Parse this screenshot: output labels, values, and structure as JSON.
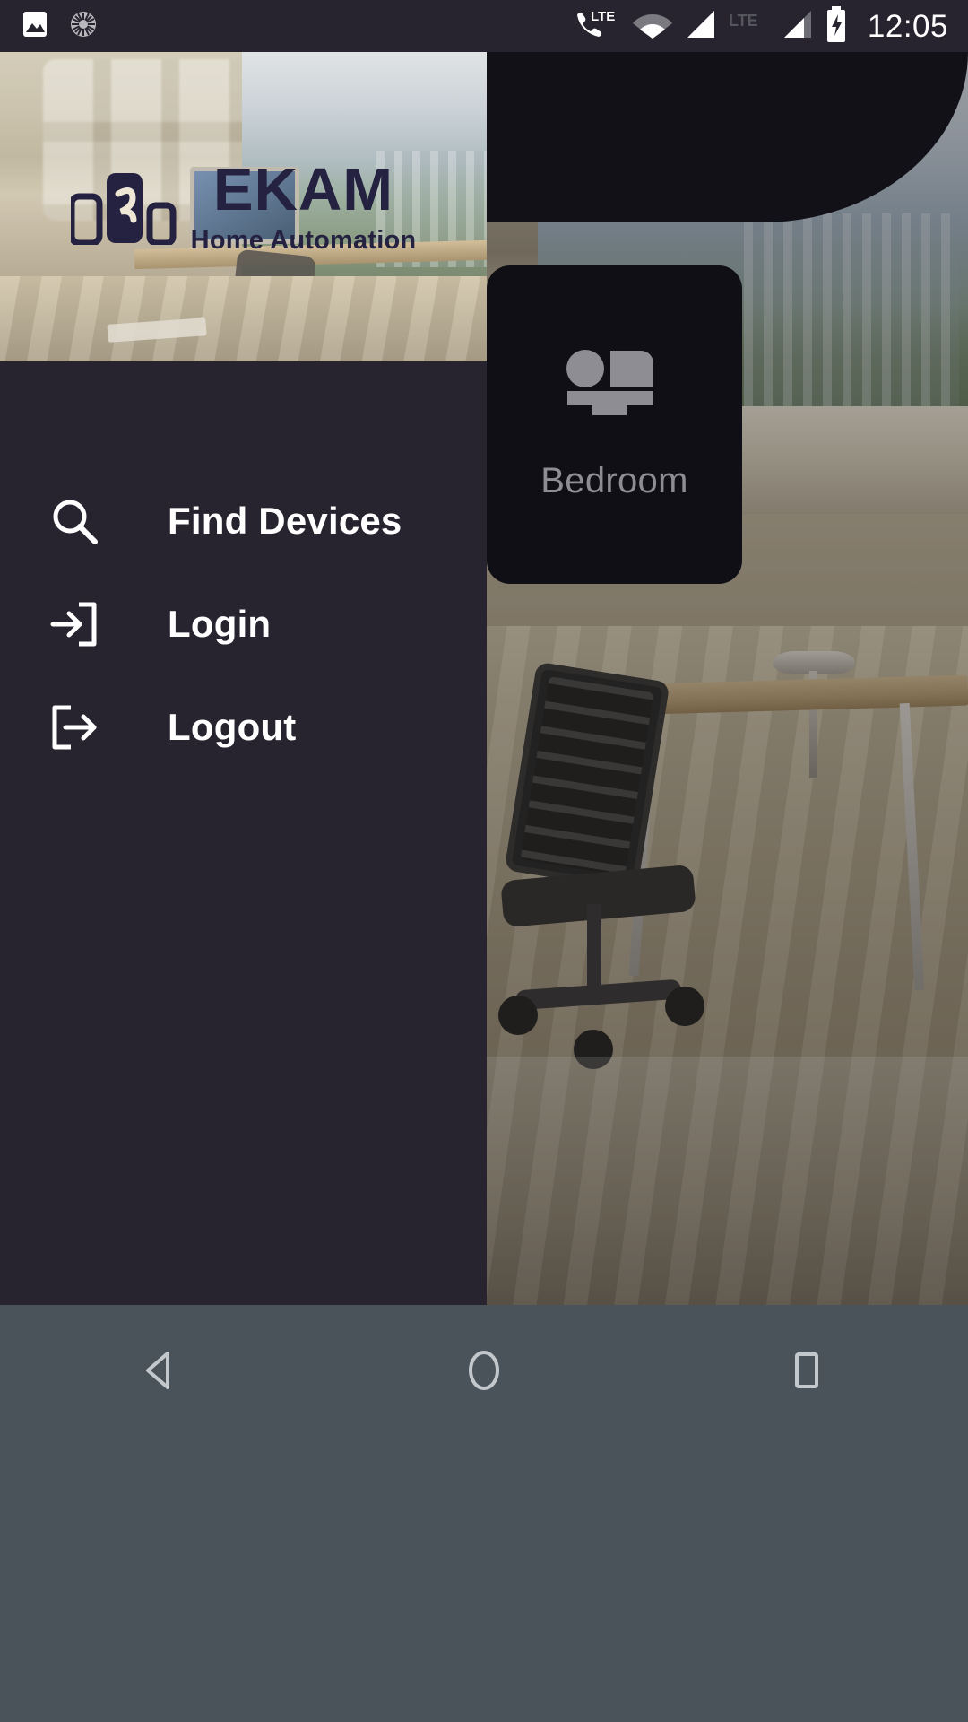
{
  "status_bar": {
    "background_color": "#272430",
    "clock": "12:05",
    "left_icons": [
      {
        "name": "image-icon",
        "label": "Screenshot"
      },
      {
        "name": "sync-icon",
        "label": "Sync"
      }
    ],
    "right_icons": [
      {
        "name": "phone-lte-icon",
        "label": "VoLTE"
      },
      {
        "name": "wifi-icon",
        "label": "Wi-Fi"
      },
      {
        "name": "signal-icon-1",
        "label": "Signal SIM 1"
      },
      {
        "name": "lte-label-icon",
        "label": "LTE"
      },
      {
        "name": "signal-icon-2",
        "label": "Signal SIM 2"
      },
      {
        "name": "battery-charging-icon",
        "label": "Battery charging"
      }
    ]
  },
  "drawer": {
    "background_color": "#272430",
    "brand": {
      "title": "EKAM",
      "subtitle": "Home Automation",
      "text_color": "#242240",
      "logo_icon": "ekam-devices-logo-icon"
    },
    "items": [
      {
        "icon": "search-icon",
        "label": "Find Devices"
      },
      {
        "icon": "login-icon",
        "label": "Login"
      },
      {
        "icon": "logout-icon",
        "label": "Logout"
      }
    ]
  },
  "main": {
    "rooms": [
      {
        "icon": "bed-icon",
        "label": "Bedroom",
        "card_color": "#100f15",
        "label_color": "#8d8d93"
      }
    ]
  },
  "nav_bar": {
    "background_color": "#4a525a",
    "buttons": [
      {
        "name": "back-button",
        "label": "Back"
      },
      {
        "name": "home-button",
        "label": "Home"
      },
      {
        "name": "recents-button",
        "label": "Recents"
      }
    ]
  }
}
